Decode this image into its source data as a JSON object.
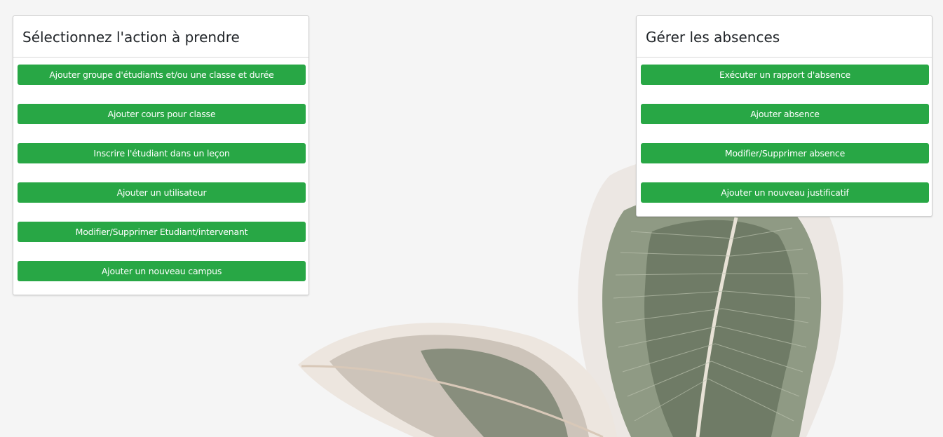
{
  "colors": {
    "button_green": "#28a745",
    "page_background": "#f5f5f5"
  },
  "actions_panel": {
    "title": "Sélectionnez l'action à prendre",
    "buttons": [
      "Ajouter groupe d'étudiants et/ou une classe et durée",
      "Ajouter cours pour classe",
      "Inscrire l'étudiant dans un leçon",
      "Ajouter un utilisateur",
      "Modifier/Supprimer Etudiant/intervenant",
      "Ajouter un nouveau campus"
    ]
  },
  "absences_panel": {
    "title": "Gérer les absences",
    "buttons": [
      "Exécuter un rapport d'absence",
      "Ajouter absence",
      "Modifier/Supprimer absence",
      "Ajouter un nouveau justificatif"
    ]
  },
  "background": {
    "image": "leaf-photo"
  }
}
